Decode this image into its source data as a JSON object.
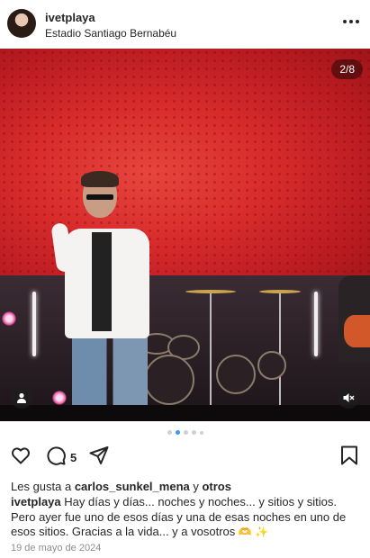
{
  "header": {
    "username": "ivetplaya",
    "location": "Estadio Santiago Bernabéu",
    "more_icon": "more-horizontal-icon"
  },
  "media": {
    "counter": "2/8",
    "user_tag_icon": "person-icon",
    "mute_icon": "speaker-muted-icon",
    "carousel": {
      "total": 5,
      "active_index": 1
    }
  },
  "actions": {
    "like_icon": "heart-icon",
    "comment_icon": "comment-bubble-icon",
    "comment_count": "5",
    "share_icon": "paper-plane-icon",
    "save_icon": "bookmark-icon"
  },
  "likes": {
    "prefix": "Les gusta a ",
    "user": "carlos_sunkel_mena",
    "joiner": " y ",
    "others": "otros"
  },
  "caption": {
    "user": "ivetplaya",
    "text": "Hay días y días... noches y noches... y sitios y sitios. Pero ayer fue uno de esos días y una de esas noches en uno de esos sitios. Gracias a la vida... y a vosotros ",
    "emojis": "🫶 ✨"
  },
  "date": "19 de mayo de 2024",
  "colors": {
    "text": "#262626",
    "muted": "#8e8e8e",
    "carousel_active": "#3897f0",
    "stage_red": "#d72b2b"
  }
}
